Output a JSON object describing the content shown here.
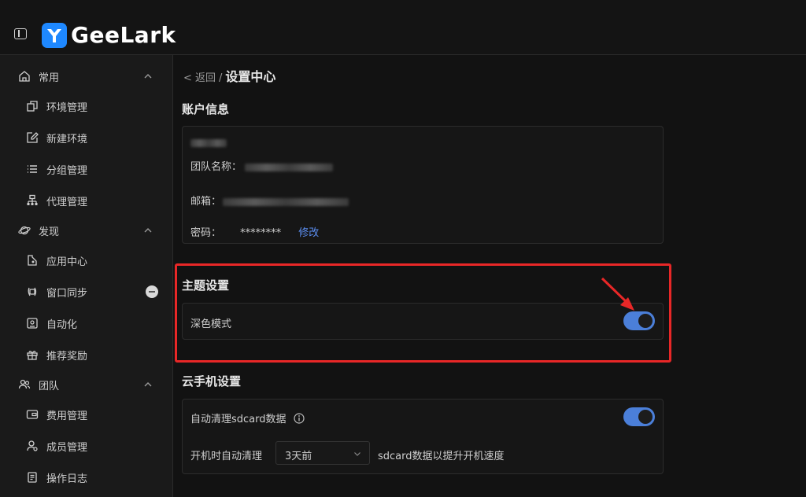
{
  "app": {
    "logo_text": "GeeLark"
  },
  "sidebar": {
    "sections": [
      {
        "label": "常用",
        "icon": "home-icon",
        "items": [
          {
            "label": "环境管理",
            "icon": "environment-icon"
          },
          {
            "label": "新建环境",
            "icon": "edit-icon"
          },
          {
            "label": "分组管理",
            "icon": "list-icon"
          },
          {
            "label": "代理管理",
            "icon": "network-icon"
          }
        ]
      },
      {
        "label": "发现",
        "icon": "planet-icon",
        "items": [
          {
            "label": "应用中心",
            "icon": "app-center-icon"
          },
          {
            "label": "窗口同步",
            "icon": "sync-icon"
          },
          {
            "label": "自动化",
            "icon": "automation-icon"
          },
          {
            "label": "推荐奖励",
            "icon": "gift-icon"
          }
        ]
      },
      {
        "label": "团队",
        "icon": "team-icon",
        "items": [
          {
            "label": "费用管理",
            "icon": "wallet-icon"
          },
          {
            "label": "成员管理",
            "icon": "member-icon"
          },
          {
            "label": "操作日志",
            "icon": "log-icon"
          }
        ]
      }
    ]
  },
  "breadcrumb": {
    "back": "< 返回",
    "sep": "/",
    "current": "设置中心"
  },
  "account": {
    "title": "账户信息",
    "team_label": "团队名称：",
    "email_label": "邮箱：",
    "password_label": "密码：",
    "password_value": "********",
    "modify_link": "修改"
  },
  "theme": {
    "title": "主题设置",
    "dark_mode_label": "深色模式",
    "dark_mode_on": true
  },
  "cloud_phone": {
    "title": "云手机设置",
    "auto_clean_label": "自动清理sdcard数据",
    "auto_clean_on": true,
    "boot_clean_label": "开机时自动清理",
    "boot_clean_value": "3天前",
    "boot_clean_suffix": "sdcard数据以提升开机速度"
  },
  "colors": {
    "accent": "#4b7fd9",
    "link": "#5b8def",
    "highlight": "#e82727",
    "logo": "#1e88ff"
  }
}
